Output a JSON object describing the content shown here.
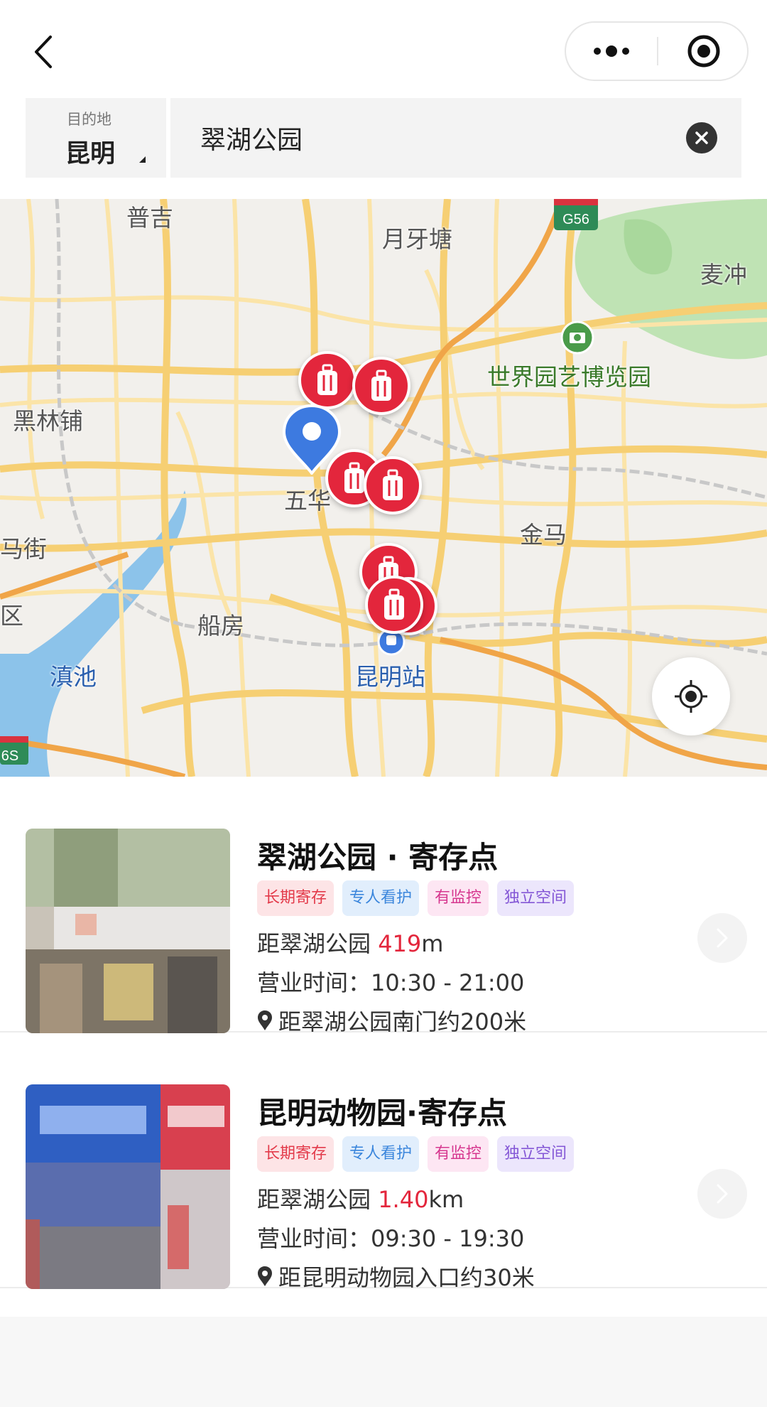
{
  "nav": {
    "back_icon": "chevron-left-icon",
    "more_icon": "more-dots-icon",
    "close_icon": "target-circle-icon"
  },
  "search": {
    "dest_label": "目的地",
    "dest_city": "昆明",
    "query": "翠湖公园"
  },
  "map": {
    "places": [
      "普吉",
      "月牙塘",
      "麦冲",
      "世界园艺博览园",
      "黑林铺",
      "五华",
      "金马",
      "马街",
      "船房",
      "区",
      "滇池",
      "昆明站"
    ],
    "shields": [
      "G56",
      "6S"
    ],
    "colors": {
      "marker": "#e3263c",
      "user": "#3d7ae0",
      "road": "#f6cf73",
      "water": "#8cc3ea",
      "park": "#bfe3b4"
    }
  },
  "results": [
    {
      "title": "翠湖公园 · 寄存点",
      "tags": [
        "长期寄存",
        "专人看护",
        "有监控",
        "独立空间"
      ],
      "dist_prefix": "距翠湖公园 ",
      "dist_value": "419",
      "dist_unit": "m",
      "hours": "营业时间：10:30 - 21:00",
      "addr": "距翠湖公园南门约200米"
    },
    {
      "title": "昆明动物园·寄存点",
      "tags": [
        "长期寄存",
        "专人看护",
        "有监控",
        "独立空间"
      ],
      "dist_prefix": "距翠湖公园 ",
      "dist_value": "1.40",
      "dist_unit": "km",
      "hours": "营业时间：09:30 - 19:30",
      "addr": "距昆明动物园入口约30米"
    }
  ]
}
